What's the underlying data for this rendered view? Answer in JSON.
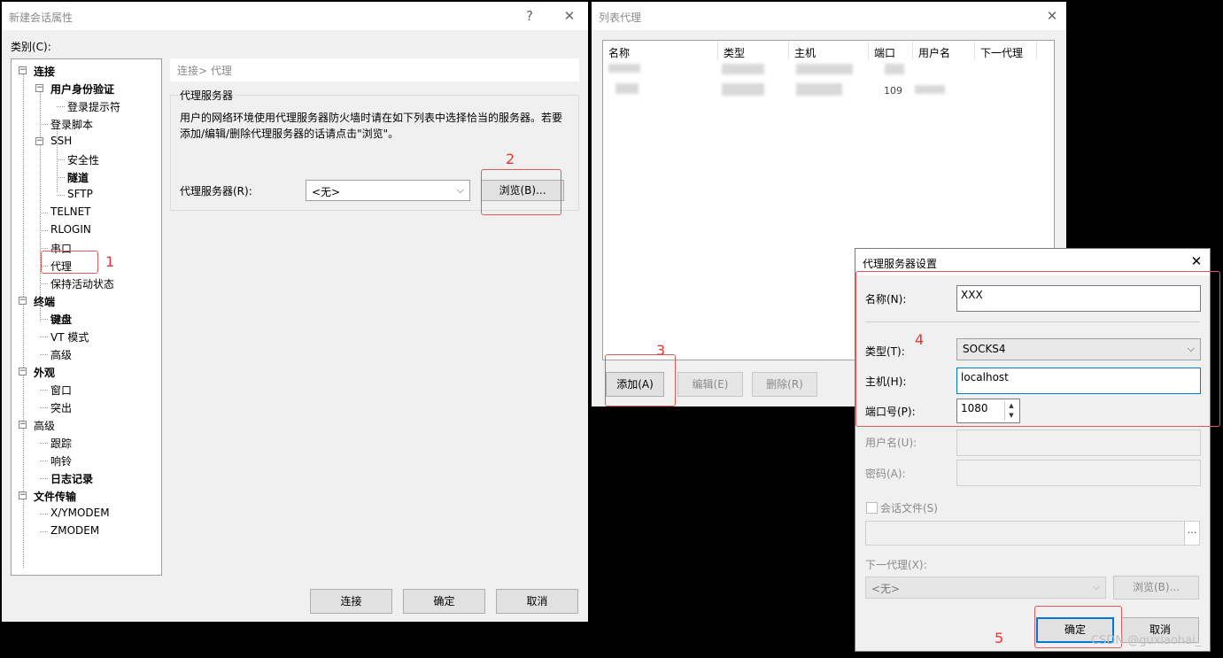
{
  "main_dialog": {
    "title": "新建会话属性",
    "help": "?",
    "close": "✕",
    "category_label": "类别(C):",
    "breadcrumb": "连接> 代理",
    "group_title": "代理服务器",
    "description_line1": "用户的网络环境使用代理服务器防火墙时请在如下列表中选择恰当的服务器。若要",
    "description_line2": "添加/编辑/删除代理服务器的话请点击\"浏览\"。",
    "proxy_label": "代理服务器(R):",
    "proxy_value": "<无>",
    "browse_button": "浏览(B)...",
    "connect_button": "连接",
    "ok_button": "确定",
    "cancel_button": "取消",
    "tree": [
      {
        "label": "连接",
        "bold": true
      },
      {
        "label": "用户身份验证",
        "bold": true
      },
      {
        "label": "登录提示符",
        "bold": false
      },
      {
        "label": "登录脚本",
        "bold": false
      },
      {
        "label": "SSH",
        "bold": false
      },
      {
        "label": "安全性",
        "bold": false
      },
      {
        "label": "隧道",
        "bold": true
      },
      {
        "label": "SFTP",
        "bold": false
      },
      {
        "label": "TELNET",
        "bold": false
      },
      {
        "label": "RLOGIN",
        "bold": false
      },
      {
        "label": "串口",
        "bold": false
      },
      {
        "label": "代理",
        "bold": false
      },
      {
        "label": "保持活动状态",
        "bold": false
      },
      {
        "label": "终端",
        "bold": true
      },
      {
        "label": "键盘",
        "bold": true
      },
      {
        "label": "VT 模式",
        "bold": false
      },
      {
        "label": "高级",
        "bold": false
      },
      {
        "label": "外观",
        "bold": true
      },
      {
        "label": "窗口",
        "bold": false
      },
      {
        "label": "突出",
        "bold": false
      },
      {
        "label": "高级",
        "bold": false
      },
      {
        "label": "跟踪",
        "bold": false
      },
      {
        "label": "响铃",
        "bold": false
      },
      {
        "label": "日志记录",
        "bold": true
      },
      {
        "label": "文件传输",
        "bold": true
      },
      {
        "label": "X/YMODEM",
        "bold": false
      },
      {
        "label": "ZMODEM",
        "bold": false
      }
    ]
  },
  "list_dialog": {
    "title": "列表代理",
    "close": "✕",
    "columns": [
      "名称",
      "类型",
      "主机",
      "端口",
      "用户名",
      "下一代理"
    ],
    "port_partial": "109",
    "add_button": "添加(A)",
    "edit_button": "编辑(E)",
    "delete_button": "删除(R)"
  },
  "settings_dialog": {
    "title": "代理服务器设置",
    "close": "✕",
    "name_label": "名称(N):",
    "name_value": "XXX",
    "type_label": "类型(T):",
    "type_value": "SOCKS4",
    "host_label": "主机(H):",
    "host_value": "localhost",
    "port_label": "端口号(P):",
    "port_value": "1080",
    "user_label": "用户名(U):",
    "password_label": "密码(A):",
    "session_file_label": "会话文件(S)",
    "session_file_browse": "...",
    "next_proxy_label": "下一代理(X):",
    "next_proxy_value": "<无>",
    "next_proxy_browse": "浏览(B)...",
    "ok_button": "确定",
    "cancel_button": "取消"
  },
  "annotations": {
    "n1": "1",
    "n2": "2",
    "n3": "3",
    "n4": "4",
    "n5": "5",
    "color": "#e33333"
  },
  "watermark": "CSDN @guxiaohai_",
  "icons": {
    "expand": "⊟",
    "dropdown": "chevron-down-icon",
    "spin": "spin-arrows-icon"
  }
}
